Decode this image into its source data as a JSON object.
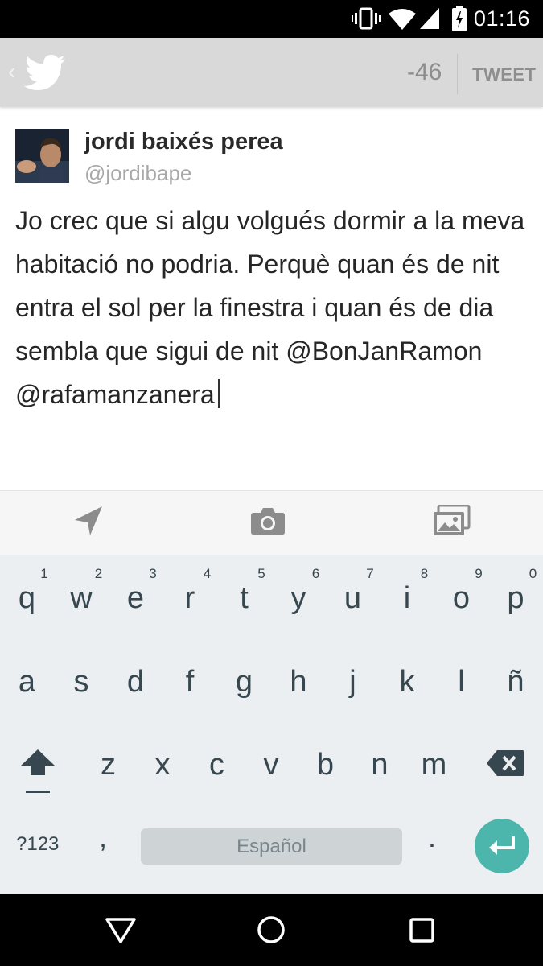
{
  "status_bar": {
    "time": "01:16"
  },
  "action_bar": {
    "back_glyph": "‹",
    "char_count": "-46",
    "tweet_label": "TWEET"
  },
  "user": {
    "name": "jordi baixés perea",
    "handle": "@jordibape"
  },
  "compose": {
    "text": "Jo crec que si algu volgués dormir a la meva habitació no podria. Perquè quan és de nit entra el sol per la finestra i quan és de dia sembla que sigui de nit @BonJanRamon @rafamanzanera"
  },
  "attach_bar": {
    "icons": [
      "location-icon",
      "camera-icon",
      "gallery-icon"
    ]
  },
  "keyboard": {
    "row1": [
      {
        "k": "q",
        "h": "1"
      },
      {
        "k": "w",
        "h": "2"
      },
      {
        "k": "e",
        "h": "3"
      },
      {
        "k": "r",
        "h": "4"
      },
      {
        "k": "t",
        "h": "5"
      },
      {
        "k": "y",
        "h": "6"
      },
      {
        "k": "u",
        "h": "7"
      },
      {
        "k": "i",
        "h": "8"
      },
      {
        "k": "o",
        "h": "9"
      },
      {
        "k": "p",
        "h": "0"
      }
    ],
    "row2": [
      "a",
      "s",
      "d",
      "f",
      "g",
      "h",
      "j",
      "k",
      "l",
      "ñ"
    ],
    "row3": [
      "z",
      "x",
      "c",
      "v",
      "b",
      "n",
      "m"
    ],
    "symbols_label": "?123",
    "comma": ",",
    "space_label": "Español",
    "period": "."
  },
  "colors": {
    "accent": "#4db6ac",
    "key_text": "#37474f",
    "keyboard_bg": "#eceff1"
  }
}
